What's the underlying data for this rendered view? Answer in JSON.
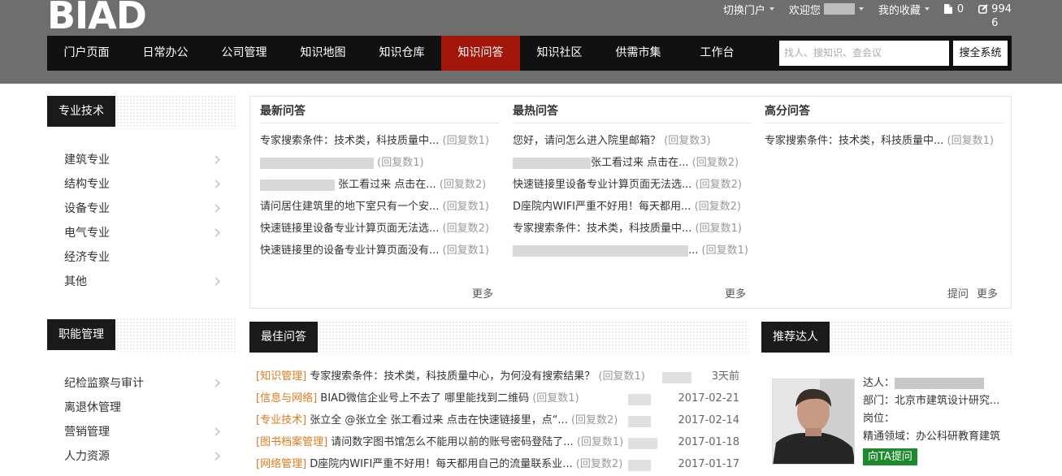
{
  "header": {
    "logo": "BIAD",
    "switch_portal": "切换门户",
    "welcome": "欢迎您",
    "favorites": "我的收藏",
    "doc_count": "0",
    "edit_count_line1": "994",
    "edit_count_line2": "6"
  },
  "nav": {
    "items": [
      "门户页面",
      "日常办公",
      "公司管理",
      "知识地图",
      "知识仓库",
      "知识问答",
      "知识社区",
      "供需市集",
      "工作台"
    ],
    "active_index": 5,
    "search_placeholder": "找人、搜知识、查会议",
    "search_button": "搜全系统"
  },
  "sidebar": {
    "section1_title": "专业技术",
    "section1_items": [
      "建筑专业",
      "结构专业",
      "设备专业",
      "电气专业",
      "经济专业",
      "其他"
    ],
    "section2_title": "职能管理",
    "section2_items": [
      "纪检监察与审计",
      "离退休管理",
      "营销管理",
      "人力资源"
    ]
  },
  "qa": {
    "latest": {
      "title": "最新问答",
      "items": [
        {
          "text": "专家搜索条件：技术类，科技质量中...",
          "count": "(回复数1)"
        },
        {
          "text": "",
          "count": "(回复数1)"
        },
        {
          "text": "张工看过来 点击在...",
          "count": "(回复数2)"
        },
        {
          "text": "请问居住建筑里的地下室只有一个安...",
          "count": "(回复数1)"
        },
        {
          "text": "快速链接里设备专业计算页面无法选...",
          "count": "(回复数2)"
        },
        {
          "text": "快速链接里的设备专业计算页面没有...",
          "count": "(回复数1)"
        }
      ],
      "more": "更多"
    },
    "hottest": {
      "title": "最热问答",
      "items": [
        {
          "text": "您好，请问怎么进入院里邮箱？",
          "count": "(回复数3)"
        },
        {
          "text": "张工看过来 点击在...",
          "count": "(回复数2)"
        },
        {
          "text": "快速链接里设备专业计算页面无法选...",
          "count": "(回复数2)"
        },
        {
          "text": "D座院内WIFI严重不好用！每天都用...",
          "count": "(回复数2)"
        },
        {
          "text": "专家搜索条件：技术类，科技质量中...",
          "count": "(回复数1)"
        },
        {
          "text": "...",
          "count": "(回复数1)"
        }
      ],
      "more": "更多"
    },
    "highscore": {
      "title": "高分问答",
      "items": [
        {
          "text": "专家搜索条件：技术类，科技质量中...",
          "count": "(回复数1)"
        }
      ],
      "ask": "提问",
      "more": "更多"
    }
  },
  "best": {
    "title": "最佳问答",
    "rows": [
      {
        "tag": "[知识管理]",
        "text": "专家搜索条件：技术类，科技质量中心，为何没有搜索结果？",
        "count": "(回复数1)",
        "date": "3天前"
      },
      {
        "tag": "[信息与网络]",
        "text": "BIAD微信企业号上不去了 哪里能找到二维码",
        "count": "(回复数1)",
        "date": "2017-02-21"
      },
      {
        "tag": "[专业技术]",
        "text": "张立全 @张立全 张工看过来 点击在快速链接里，点“...",
        "count": "(回复数2)",
        "date": "2017-02-14"
      },
      {
        "tag": "[图书档案管理]",
        "text": "请问数字图书馆怎么不能用以前的账号密码登陆了...",
        "count": "(回复数1)",
        "date": "2017-01-18"
      },
      {
        "tag": "[网络管理]",
        "text": "D座院内WIFI严重不好用！每天都用自己的流量联系业...",
        "count": "(回复数2)",
        "date": "2017-01-17"
      }
    ]
  },
  "expert": {
    "title": "推荐达人",
    "name_label": "达人：",
    "dept": "部门：北京市建筑设计研究...",
    "post": "岗位：",
    "field": "精通领域：办公科研教育建筑",
    "ask_button": "向TA提问"
  }
}
